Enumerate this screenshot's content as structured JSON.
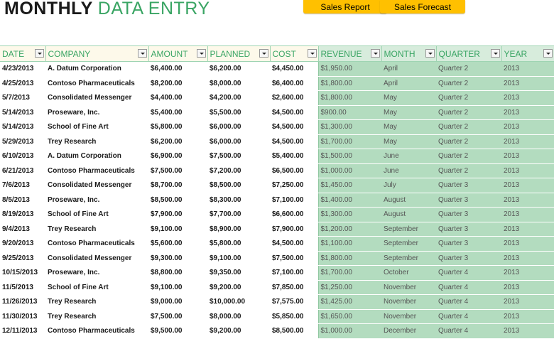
{
  "header": {
    "title_bold": "MONTHLY",
    "title_light": "DATA ENTRY",
    "buttons": {
      "sales_report": "Sales Report",
      "sales_forecast": "Sales Forecast"
    }
  },
  "table": {
    "columns": [
      "DATE",
      "COMPANY",
      "AMOUNT",
      "PLANNED",
      "COST",
      "REVENUE",
      "MONTH",
      "QUARTER",
      "YEAR"
    ],
    "rows": [
      [
        "4/23/2013",
        "A. Datum Corporation",
        "$6,400.00",
        "$6,200.00",
        "$4,450.00",
        "$1,950.00",
        "April",
        "Quarter 2",
        "2013"
      ],
      [
        "4/25/2013",
        "Contoso Pharmaceuticals",
        "$8,200.00",
        "$8,000.00",
        "$6,400.00",
        "$1,800.00",
        "April",
        "Quarter 2",
        "2013"
      ],
      [
        "5/7/2013",
        "Consolidated Messenger",
        "$4,400.00",
        "$4,200.00",
        "$2,600.00",
        "$1,800.00",
        "May",
        "Quarter 2",
        "2013"
      ],
      [
        "5/14/2013",
        "Proseware, Inc.",
        "$5,400.00",
        "$5,500.00",
        "$4,500.00",
        "$900.00",
        "May",
        "Quarter 2",
        "2013"
      ],
      [
        "5/14/2013",
        "School of Fine Art",
        "$5,800.00",
        "$6,000.00",
        "$4,500.00",
        "$1,300.00",
        "May",
        "Quarter 2",
        "2013"
      ],
      [
        "5/29/2013",
        "Trey Research",
        "$6,200.00",
        "$6,000.00",
        "$4,500.00",
        "$1,700.00",
        "May",
        "Quarter 2",
        "2013"
      ],
      [
        "6/10/2013",
        "A. Datum Corporation",
        "$6,900.00",
        "$7,500.00",
        "$5,400.00",
        "$1,500.00",
        "June",
        "Quarter 2",
        "2013"
      ],
      [
        "6/21/2013",
        "Contoso Pharmaceuticals",
        "$7,500.00",
        "$7,200.00",
        "$6,500.00",
        "$1,000.00",
        "June",
        "Quarter 2",
        "2013"
      ],
      [
        "7/6/2013",
        "Consolidated Messenger",
        "$8,700.00",
        "$8,500.00",
        "$7,250.00",
        "$1,450.00",
        "July",
        "Quarter 3",
        "2013"
      ],
      [
        "8/5/2013",
        "Proseware, Inc.",
        "$8,500.00",
        "$8,300.00",
        "$7,100.00",
        "$1,400.00",
        "August",
        "Quarter 3",
        "2013"
      ],
      [
        "8/19/2013",
        "School of Fine Art",
        "$7,900.00",
        "$7,700.00",
        "$6,600.00",
        "$1,300.00",
        "August",
        "Quarter 3",
        "2013"
      ],
      [
        "9/4/2013",
        "Trey Research",
        "$9,100.00",
        "$8,900.00",
        "$7,900.00",
        "$1,200.00",
        "September",
        "Quarter 3",
        "2013"
      ],
      [
        "9/20/2013",
        "Contoso Pharmaceuticals",
        "$5,600.00",
        "$5,800.00",
        "$4,500.00",
        "$1,100.00",
        "September",
        "Quarter 3",
        "2013"
      ],
      [
        "9/25/2013",
        "Consolidated Messenger",
        "$9,300.00",
        "$9,100.00",
        "$7,500.00",
        "$1,800.00",
        "September",
        "Quarter 3",
        "2013"
      ],
      [
        "10/15/2013",
        "Proseware, Inc.",
        "$8,800.00",
        "$9,350.00",
        "$7,100.00",
        "$1,700.00",
        "October",
        "Quarter 4",
        "2013"
      ],
      [
        "11/5/2013",
        "School of Fine Art",
        "$9,100.00",
        "$9,200.00",
        "$7,850.00",
        "$1,250.00",
        "November",
        "Quarter 4",
        "2013"
      ],
      [
        "11/26/2013",
        "Trey Research",
        "$9,000.00",
        "$10,000.00",
        "$7,575.00",
        "$1,425.00",
        "November",
        "Quarter 4",
        "2013"
      ],
      [
        "11/30/2013",
        "Trey Research",
        "$7,500.00",
        "$8,000.00",
        "$5,850.00",
        "$1,650.00",
        "November",
        "Quarter 4",
        "2013"
      ],
      [
        "12/11/2013",
        "Contoso Pharmaceuticals",
        "$9,500.00",
        "$9,200.00",
        "$8,500.00",
        "$1,000.00",
        "December",
        "Quarter 4",
        "2013"
      ]
    ]
  },
  "theme": {
    "accent": "#3aa564",
    "button": "#ffc000",
    "calc_fill": "#b3dcbf",
    "header_fill": "#fdf9ea"
  }
}
